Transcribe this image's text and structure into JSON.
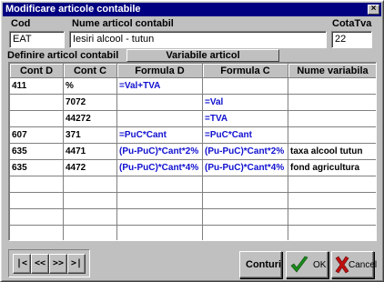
{
  "window": {
    "title": "Modificare articole contabile",
    "close_glyph": "×"
  },
  "fields": {
    "cod_label": "Cod",
    "nume_label": "Nume articol contabil",
    "cotatva_label": "CotaTva",
    "cod_value": "EAT",
    "nume_value": "Iesiri alcool - tutun",
    "cotatva_value": "22"
  },
  "tabs": {
    "definire": "Definire articol contabil",
    "variabile": "Variabile articol"
  },
  "grid": {
    "columns": [
      "Cont D",
      "Cont C",
      "Formula D",
      "Formula C",
      "Nume variabila"
    ],
    "rows": [
      [
        "411",
        "%",
        "=Val+TVA",
        "",
        ""
      ],
      [
        "",
        "7072",
        "",
        "=Val",
        ""
      ],
      [
        "",
        "44272",
        "",
        "=TVA",
        ""
      ],
      [
        "607",
        "371",
        "=PuC*Cant",
        "=PuC*Cant",
        ""
      ],
      [
        "635",
        "4471",
        "(Pu-PuC)*Cant*2%",
        "(Pu-PuC)*Cant*2%",
        "taxa alcool tutun"
      ],
      [
        "635",
        "4472",
        "(Pu-PuC)*Cant*4%",
        "(Pu-PuC)*Cant*4%",
        "fond agricultura"
      ],
      [
        "",
        "",
        "",
        "",
        ""
      ],
      [
        "",
        "",
        "",
        "",
        ""
      ],
      [
        "",
        "",
        "",
        "",
        ""
      ],
      [
        "",
        "",
        "",
        "",
        ""
      ]
    ]
  },
  "nav": {
    "first": "|<",
    "prev": "<<",
    "next": ">>",
    "last": ">|"
  },
  "buttons": {
    "conturi": "Conturi",
    "ok": "OK",
    "cancel": "Cancel"
  },
  "colors": {
    "titlebar": "#000080",
    "formula_text": "#1010d0",
    "ok_check": "#1a8a1a",
    "cancel_x": "#c01010"
  },
  "icons": {
    "ok": "check-icon",
    "cancel": "x-icon"
  }
}
